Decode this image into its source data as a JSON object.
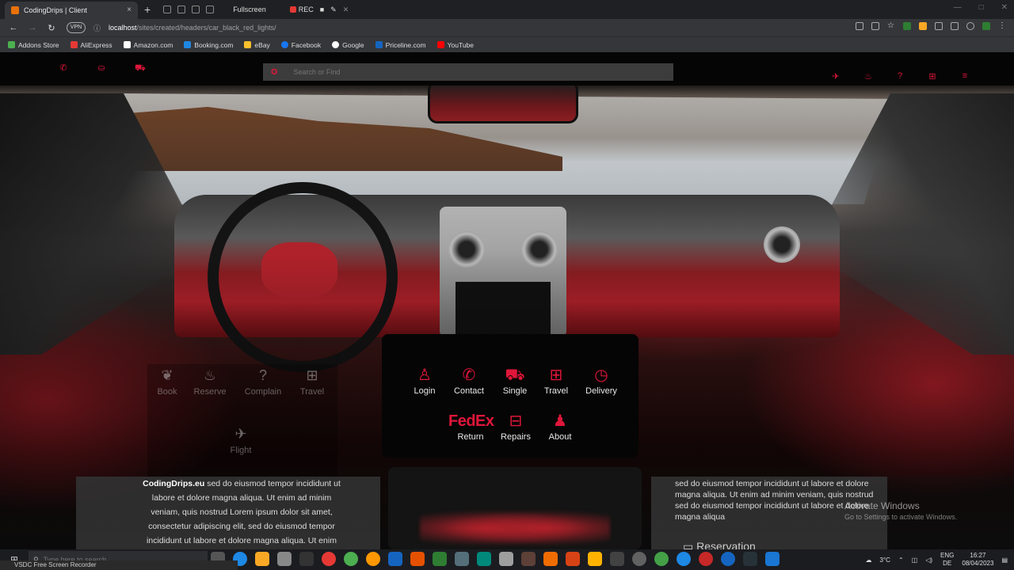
{
  "browser": {
    "tab_title": "CodingDrips | Client",
    "tab_close": "×",
    "new_tab": "+",
    "fullscreen_label": "Fullscreen",
    "rec_label": "REC",
    "vpn_label": "VPN",
    "url_host": "localhost",
    "url_path": "/sites/created/headers/car_black_red_lights/",
    "bookmarks": [
      "Addons Store",
      "AliExpress",
      "Amazon.com",
      "Booking.com",
      "eBay",
      "Facebook",
      "Google",
      "Priceline.com",
      "YouTube"
    ],
    "bookmark_colors": [
      "#4caf50",
      "#e53935",
      "#ffffff",
      "#1e88e5",
      "#fbc02d",
      "#1877f2",
      "#ffffff",
      "#1565c0",
      "#ff0000"
    ]
  },
  "header": {
    "search_placeholder": "Search or Find",
    "accent": "#e0163a",
    "left_icons": [
      "phone-icon",
      "gift-icon",
      "car-icon"
    ],
    "right_icons": [
      "plane-icon",
      "fire-icon",
      "help-icon",
      "gift-icon",
      "menu-icon"
    ]
  },
  "left_menu": {
    "items": [
      {
        "label": "Book",
        "icon": "sprout-icon"
      },
      {
        "label": "Reserve",
        "icon": "flame-icon"
      },
      {
        "label": "Complain",
        "icon": "question-icon"
      },
      {
        "label": "Travel",
        "icon": "gift-icon"
      },
      {
        "label": "Flight",
        "icon": "plane-icon"
      }
    ]
  },
  "menu_panel": {
    "items": [
      {
        "label": "Login",
        "icon": "user-icon"
      },
      {
        "label": "Contact",
        "icon": "phone-icon"
      },
      {
        "label": "Single",
        "icon": "car-icon"
      },
      {
        "label": "Travel",
        "icon": "gift-icon"
      },
      {
        "label": "Delivery",
        "icon": "stopwatch-icon"
      },
      {
        "label": "Return",
        "icon": "fedex-icon",
        "logo_text": "FedEx"
      },
      {
        "label": "Repairs",
        "icon": "toolbox-icon"
      },
      {
        "label": "About",
        "icon": "person-icon"
      }
    ]
  },
  "content": {
    "card1_brand": "CodingDrips.eu",
    "card1_text": " sed do eiusmod tempor incididunt ut labore et dolore magna aliqua. Ut enim ad minim veniam, quis nostrud Lorem ipsum dolor sit amet, consectetur adipiscing elit, sed do eiusmod tempor incididunt ut labore et dolore magna aliqua. Ut enim ad",
    "card3_text": "sed do eiusmod tempor incididunt ut labore et dolore magna aliqua. Ut enim ad minim veniam, quis nostrud sed do eiusmod tempor incididunt ut labore et dolore magna aliqua",
    "card3_heading": "Reservation"
  },
  "windows": {
    "activate_title": "Activate Windows",
    "activate_sub": "Go to Settings to activate Windows.",
    "search_placeholder": "Type here to search",
    "recorder_label": "VSDC Free Screen Recorder",
    "weather": "3°C",
    "lang_top": "ENG",
    "lang_bottom": "DE",
    "time": "16:27",
    "date": "08/04/2023"
  }
}
